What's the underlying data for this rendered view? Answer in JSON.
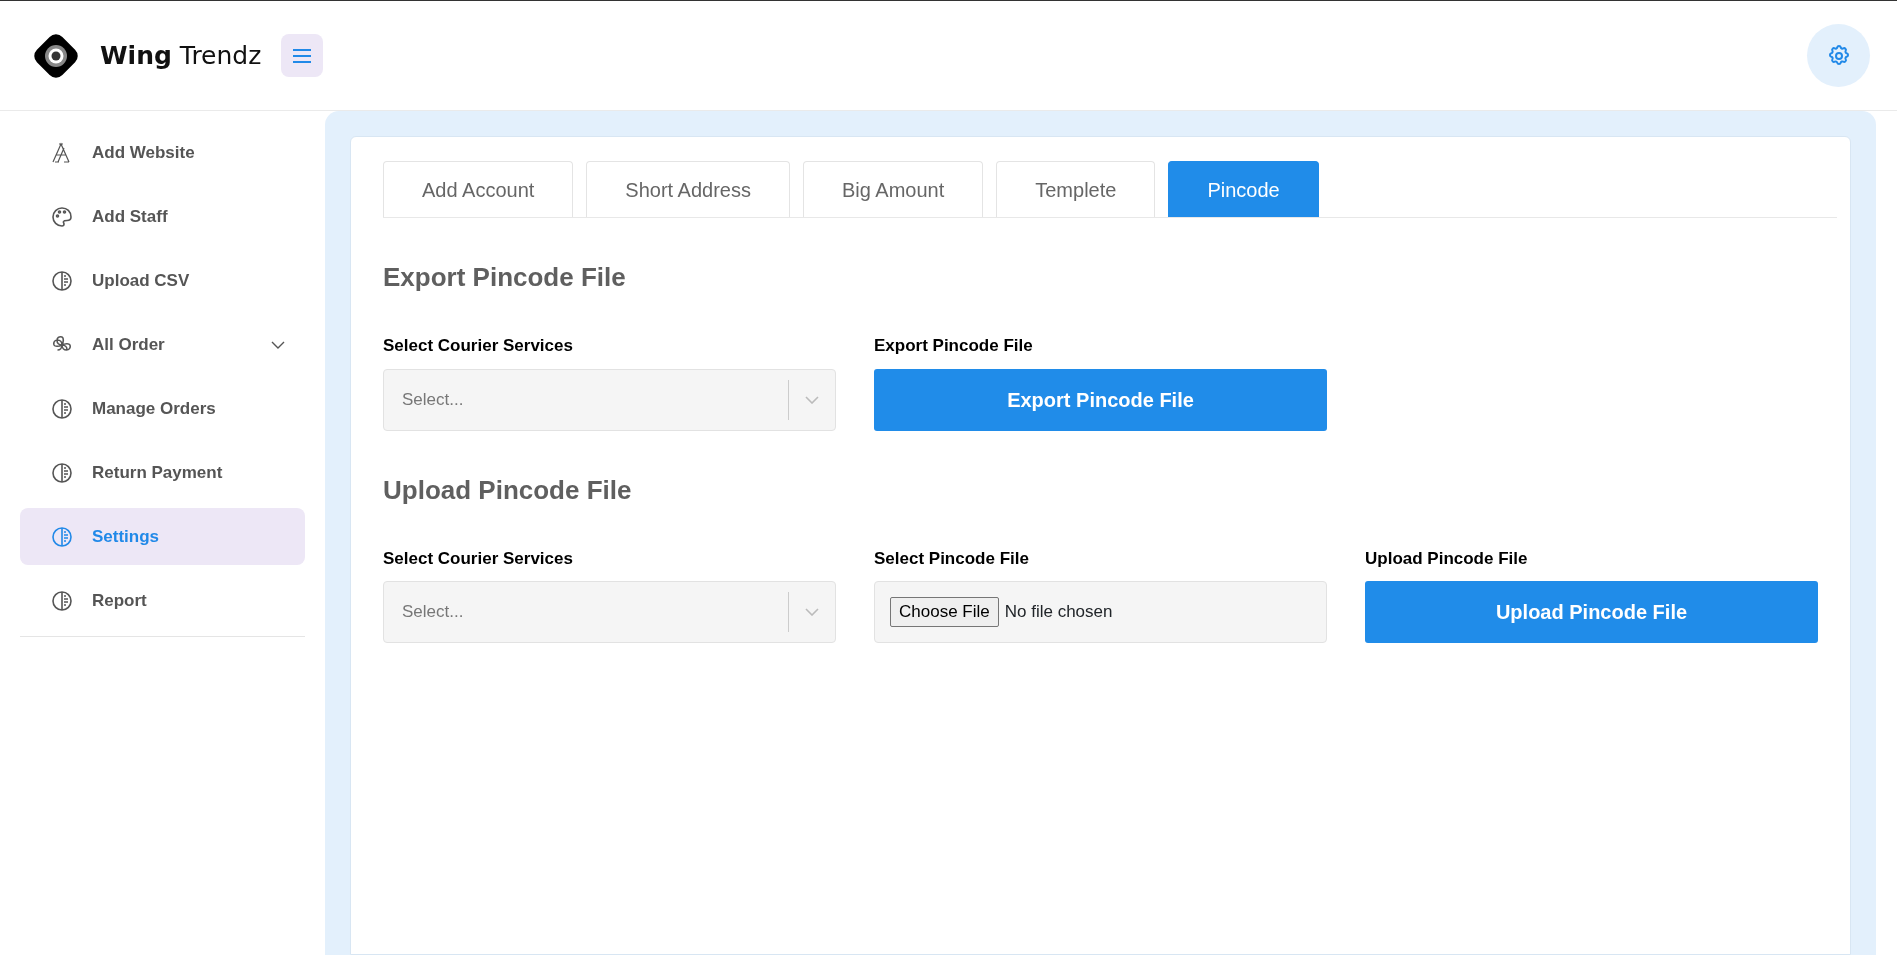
{
  "brand": {
    "name": "**Wing** Trendz"
  },
  "sidebar": {
    "items": [
      {
        "label": "Add Website",
        "kind": "link",
        "selected": false
      },
      {
        "label": "Add Staff",
        "kind": "link",
        "selected": false
      },
      {
        "label": "Upload CSV",
        "kind": "link",
        "selected": false
      },
      {
        "label": "All Order",
        "kind": "group",
        "selected": false
      },
      {
        "label": "Manage Orders",
        "kind": "link",
        "selected": false
      },
      {
        "label": "Return Payment",
        "kind": "link",
        "selected": false
      },
      {
        "label": "Settings",
        "kind": "link",
        "selected": true
      },
      {
        "label": "Report",
        "kind": "link",
        "selected": false
      }
    ]
  },
  "tabs": [
    {
      "label": "Add Account",
      "selected": false
    },
    {
      "label": "Short Address",
      "selected": false
    },
    {
      "label": "Big Amount",
      "selected": false
    },
    {
      "label": "Templete",
      "selected": false
    },
    {
      "label": "Pincode",
      "selected": true
    }
  ],
  "sections": [
    {
      "title": "Export Pincode File",
      "fields": [
        {
          "kind": "select",
          "label": "Select Courier Services",
          "placeholder": "Select..."
        },
        {
          "kind": "button",
          "label": "Export Pincode File",
          "button": "Export Pincode File"
        }
      ]
    },
    {
      "title": "Upload Pincode File",
      "fields": [
        {
          "kind": "select",
          "label": "Select Courier Services",
          "placeholder": "Select..."
        },
        {
          "kind": "file",
          "label": "Select Pincode File",
          "button": "Choose File",
          "status": "No file chosen"
        },
        {
          "kind": "button",
          "label": "Upload Pincode File",
          "button": "Upload Pincode File"
        }
      ]
    }
  ]
}
